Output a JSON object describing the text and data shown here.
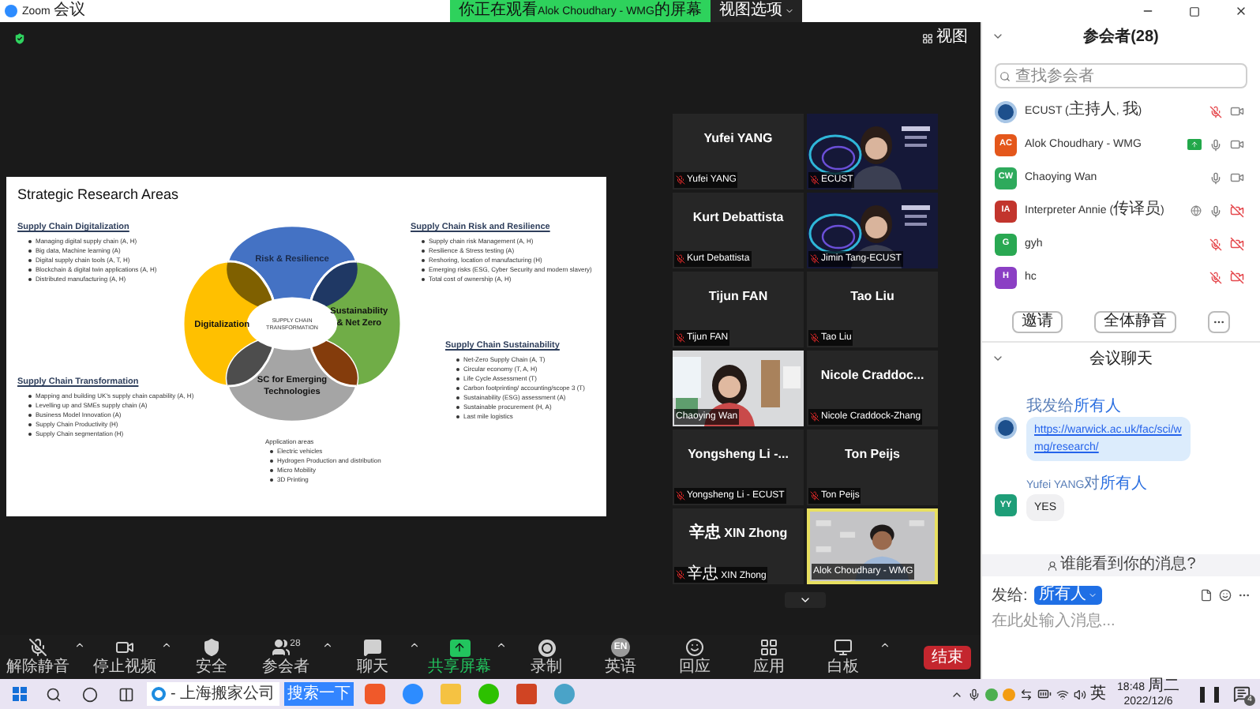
{
  "window": {
    "title": "Zoom 会议"
  },
  "share_banner": {
    "text": "你正在观看Alok Choudhary - WMG的屏幕",
    "view_options": "视图选项"
  },
  "stage": {
    "view_button": "视图"
  },
  "slide": {
    "title": "Strategic Research Areas",
    "left_column": [
      {
        "heading": "Supply Chain Digitalization",
        "bullets": [
          "Managing digital supply chain (A, H)",
          "Big data, Machine learning (A)",
          "Digital supply chain tools (A, T, H)",
          "Blockchain & digital twin applications (A, H)",
          "Distributed manufacturing (A, H)"
        ]
      },
      {
        "heading": "Supply Chain Transformation",
        "bullets": [
          "Mapping and building UK's supply chain capability (A, H)",
          "Levelling up and SMEs supply chain (A)",
          "Business Model Innovation (A)",
          "Supply Chain Productivity (H)",
          "Supply Chain segmentation (H)"
        ]
      }
    ],
    "right_column": [
      {
        "heading": "Supply Chain Risk and Resilience",
        "bullets": [
          "Supply chain risk Management (A, H)",
          "Resilience & Stress testing (A)",
          "Reshoring, location of manufacturing (H)",
          "Emerging risks (ESG, Cyber Security and modern slavery)",
          "Total cost of ownership (A, H)"
        ]
      },
      {
        "heading": "Supply Chain Sustainability",
        "bullets": [
          "Net-Zero Supply Chain (A, T)",
          "Circular economy (T, A, H)",
          "Life Cycle Assessment (T)",
          "Carbon footprinting/ accounting/scope 3 (T)",
          "Sustainability (ESG) assessment (A)",
          "Sustainable procurement (H, A)",
          "Last mile logistics"
        ]
      }
    ],
    "diagram": {
      "petals": [
        {
          "lines": [
            "Risk & Resilience"
          ],
          "color": "#4472c4"
        },
        {
          "lines": [
            "Digitalization"
          ],
          "color": "#ffc000"
        },
        {
          "lines": [
            "Sustainability",
            "& Net Zero"
          ],
          "color": "#70ad47"
        },
        {
          "lines": [
            "SC for Emerging",
            "Technologies"
          ],
          "color": "#a5a5a5"
        }
      ],
      "center_lines": [
        "SUPPLY CHAIN",
        "TRANSFORMATION"
      ]
    },
    "application_areas": {
      "title": "Application areas",
      "bullets": [
        "Electric vehicles",
        "Hydrogen Production and distribution",
        "Micro Mobility",
        "3D Printing"
      ]
    }
  },
  "gallery": [
    {
      "kind": "name",
      "display_name": "Yufei YANG",
      "tag": "Yufei YANG",
      "muted": true,
      "speaking": false
    },
    {
      "kind": "video",
      "tag": "ECUST",
      "muted": true,
      "speaking": false
    },
    {
      "kind": "name",
      "display_name": "Kurt Debattista",
      "tag": "Kurt Debattista",
      "muted": true,
      "speaking": false
    },
    {
      "kind": "video",
      "tag": "Jimin Tang-ECUST",
      "muted": true,
      "speaking": false
    },
    {
      "kind": "name",
      "display_name": "Tijun FAN",
      "tag": "Tijun FAN",
      "muted": true,
      "speaking": false
    },
    {
      "kind": "name",
      "display_name": "Tao Liu",
      "tag": "Tao Liu",
      "muted": true,
      "speaking": false
    },
    {
      "kind": "video",
      "tag": "Chaoying Wan",
      "muted": false,
      "speaking": false
    },
    {
      "kind": "name",
      "display_name": "Nicole  Craddoc...",
      "tag": "Nicole Craddock-Zhang",
      "muted": true,
      "speaking": false
    },
    {
      "kind": "name",
      "display_name": "Yongsheng Li -...",
      "tag": "Yongsheng Li - ECUST",
      "muted": true,
      "speaking": false
    },
    {
      "kind": "name",
      "display_name": "Ton Peijs",
      "tag": "Ton Peijs",
      "muted": true,
      "speaking": false
    },
    {
      "kind": "name",
      "display_name": "辛忠  XIN Zhong",
      "tag": "辛忠  XIN Zhong",
      "muted": true,
      "speaking": false
    },
    {
      "kind": "video",
      "tag": "Alok Choudhary - WMG",
      "muted": false,
      "speaking": true
    }
  ],
  "participants": {
    "title": "参会者(28)",
    "search_placeholder": "查找参会者",
    "items": [
      {
        "name": "ECUST (主持人, 我)",
        "avatar": {
          "kind": "logo"
        },
        "sharing": false,
        "interpreter": false,
        "muted": true,
        "video_off": false
      },
      {
        "name": "Alok Choudhary - WMG",
        "avatar": {
          "kind": "initials",
          "initials": "AC",
          "color": "#e4571b"
        },
        "sharing": true,
        "interpreter": false,
        "muted": false,
        "video_off": false
      },
      {
        "name": "Chaoying Wan",
        "avatar": {
          "kind": "initials",
          "initials": "CW",
          "color": "#2eaa5c"
        },
        "sharing": false,
        "interpreter": false,
        "muted": false,
        "video_off": false
      },
      {
        "name": "Interpreter Annie (传译员)",
        "avatar": {
          "kind": "initials",
          "initials": "IA",
          "color": "#c2352d"
        },
        "sharing": false,
        "interpreter": true,
        "muted": false,
        "video_off": true
      },
      {
        "name": "gyh",
        "avatar": {
          "kind": "initials",
          "initials": "G",
          "color": "#29a852"
        },
        "sharing": false,
        "interpreter": false,
        "muted": true,
        "video_off": true
      },
      {
        "name": "hc",
        "avatar": {
          "kind": "initials",
          "initials": "H",
          "color": "#8b3fc4"
        },
        "sharing": false,
        "interpreter": false,
        "muted": true,
        "video_off": true
      }
    ],
    "buttons": [
      "邀请",
      "全体静音"
    ]
  },
  "chat": {
    "title": "会议聊天",
    "messages": [
      {
        "sender": "我发给",
        "recipient": "所有人",
        "avatar": {
          "kind": "logo"
        },
        "kind": "link",
        "text": "https://warwick.ac.uk/fac/sci/wmg/research/"
      },
      {
        "sender": "Yufei YANG对",
        "recipient": "所有人",
        "avatar": {
          "kind": "initials",
          "initials": "YY",
          "color": "#1e9e78"
        },
        "kind": "text",
        "text": "YES"
      }
    ],
    "visibility_hint": "谁能看到你的消息?",
    "send_to_label": "发给:",
    "recipient": "所有人",
    "placeholder": "在此处输入消息..."
  },
  "toolbar": {
    "items": [
      {
        "label": "解除静音",
        "menu": true,
        "highlighted": false
      },
      {
        "label": "停止视频",
        "menu": true,
        "highlighted": false
      },
      {
        "label": "安全",
        "menu": false,
        "highlighted": false
      },
      {
        "label": "参会者",
        "count": "28",
        "menu": true,
        "highlighted": false
      },
      {
        "label": "聊天",
        "menu": true,
        "highlighted": false
      },
      {
        "label": "共享屏幕",
        "menu": true,
        "highlighted": true
      },
      {
        "label": "录制",
        "menu": false,
        "highlighted": false
      },
      {
        "label": "英语",
        "icon_text": "EN",
        "menu": false,
        "highlighted": false
      },
      {
        "label": "回应",
        "menu": false,
        "highlighted": false
      },
      {
        "label": "应用",
        "menu": false,
        "highlighted": false
      },
      {
        "label": "白板",
        "menu": true,
        "highlighted": false
      }
    ],
    "end_button": "结束"
  },
  "taskbar": {
    "search_text": "- 上海搬家公司",
    "search_button": "搜索一下",
    "ime": "英",
    "time": "18:48 周二",
    "date": "2022/12/6",
    "notifications": "4"
  }
}
